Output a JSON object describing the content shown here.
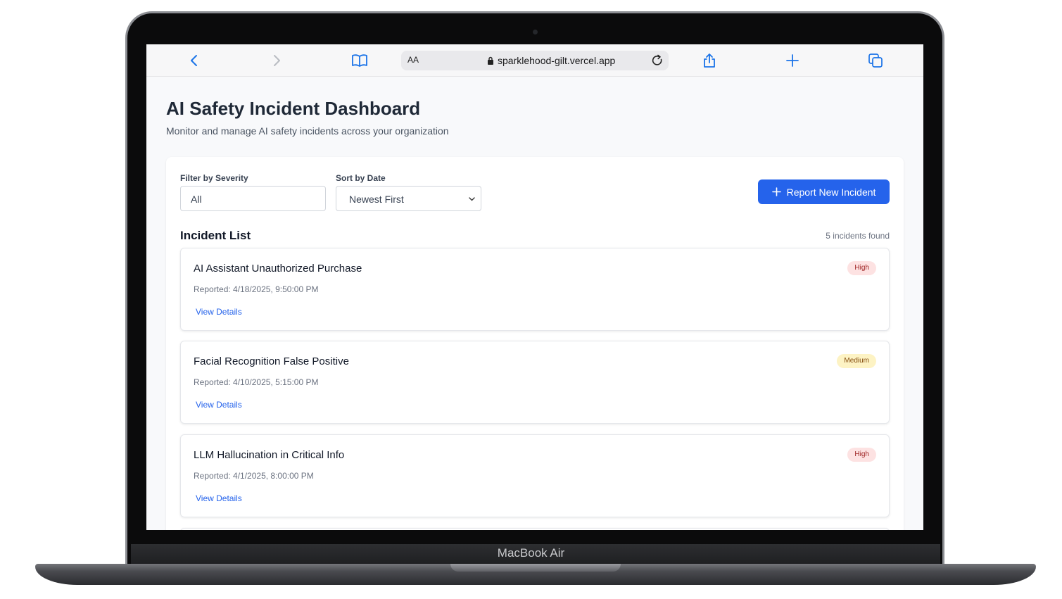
{
  "device": {
    "label": "MacBook Air"
  },
  "browser": {
    "text_size_label": "AA",
    "url": "sparklehood-gilt.vercel.app",
    "icons": [
      "back-icon",
      "forward-icon",
      "bookmarks-icon",
      "lock-icon",
      "reload-icon",
      "share-icon",
      "new-tab-icon",
      "tabs-icon"
    ]
  },
  "page": {
    "title": "AI Safety Incident Dashboard",
    "subtitle": "Monitor and manage AI safety incidents across your organization"
  },
  "filters": {
    "severity_label": "Filter by Severity",
    "severity_value": "All",
    "sort_label": "Sort by Date",
    "sort_value": "Newest First"
  },
  "actions": {
    "report_label": "Report New Incident"
  },
  "list": {
    "title": "Incident List",
    "count_text": "5 incidents found",
    "incidents": [
      {
        "title": "AI Assistant Unauthorized Purchase",
        "reported": "Reported: 4/18/2025, 9:50:00 PM",
        "severity": "High",
        "link": "View Details"
      },
      {
        "title": "Facial Recognition False Positive",
        "reported": "Reported: 4/10/2025, 5:15:00 PM",
        "severity": "Medium",
        "link": "View Details"
      },
      {
        "title": "LLM Hallucination in Critical Info",
        "reported": "Reported: 4/1/2025, 8:00:00 PM",
        "severity": "High",
        "link": "View Details"
      }
    ]
  },
  "colors": {
    "accent": "#2563eb",
    "high_bg": "#fde2e2",
    "high_text": "#9b1c1c",
    "medium_bg": "#fdf3c4",
    "medium_text": "#854d0e"
  }
}
